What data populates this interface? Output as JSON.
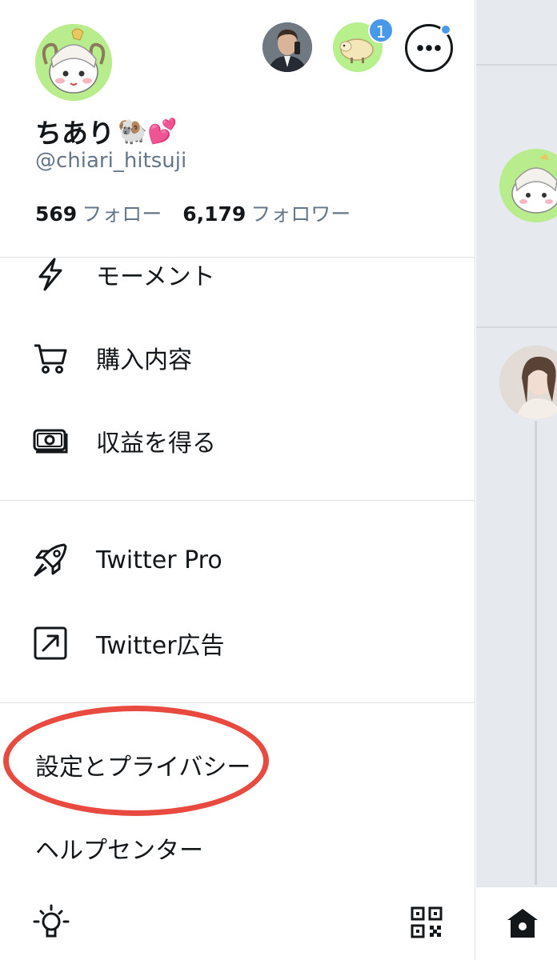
{
  "profile": {
    "display_name": "ちあり",
    "emoji": "🐏💕",
    "handle": "@chiari_hitsuji",
    "following_count": "569",
    "following_label": "フォロー",
    "followers_count": "6,179",
    "followers_label": "フォロワー"
  },
  "accounts": {
    "badge_count": "1"
  },
  "menu": {
    "section1": [
      {
        "label": "モーメント",
        "icon": "lightning-icon"
      },
      {
        "label": "購入内容",
        "icon": "cart-icon"
      },
      {
        "label": "収益を得る",
        "icon": "money-icon"
      }
    ],
    "section2": [
      {
        "label": "Twitter Pro",
        "icon": "rocket-icon"
      },
      {
        "label": "Twitter広告",
        "icon": "external-arrow-icon"
      }
    ],
    "section3": [
      {
        "label": "設定とプライバシー"
      },
      {
        "label": "ヘルプセンター"
      }
    ]
  },
  "colors": {
    "accent": "#4a99e9",
    "highlight": "#e84a3f",
    "text": "#14171a",
    "secondary_text": "#657786"
  }
}
